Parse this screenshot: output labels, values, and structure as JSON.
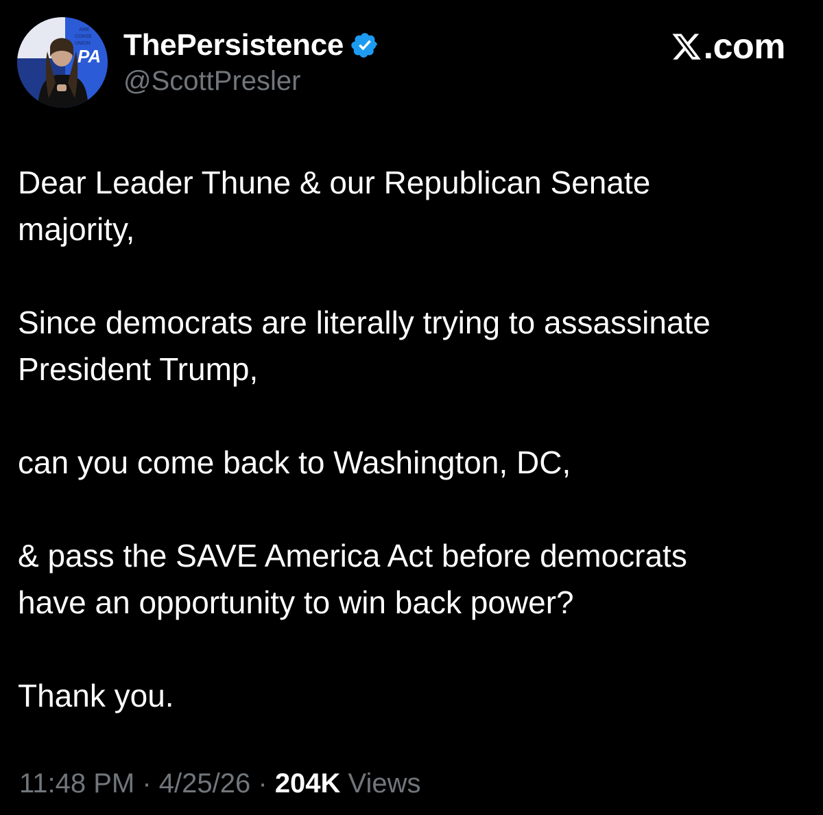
{
  "author": {
    "display_name": "ThePersistence",
    "handle": "@ScottPresler",
    "verified": true,
    "verified_color": "#1d9bf0",
    "avatar_badge_text": "AMERICAN CONSERVATIVE UNION"
  },
  "brand": {
    "icon": "x-logo-icon",
    "text": ".com"
  },
  "tweet": {
    "paragraphs": [
      [
        "Dear Leader Thune & our Republican Senate",
        "majority,"
      ],
      [
        "Since democrats are literally trying to assassinate",
        "President Trump,"
      ],
      [
        "can you come back to Washington, DC,"
      ],
      [
        "& pass the SAVE America Act before democrats",
        "have an opportunity to win back power?"
      ],
      [
        "Thank you."
      ]
    ]
  },
  "meta": {
    "time": "11:48 PM",
    "separator": " · ",
    "date": "4/25/26",
    "views_count": "204K",
    "views_label": " Views"
  },
  "colors": {
    "background": "#000000",
    "text": "#ffffff",
    "muted": "#71767b"
  }
}
